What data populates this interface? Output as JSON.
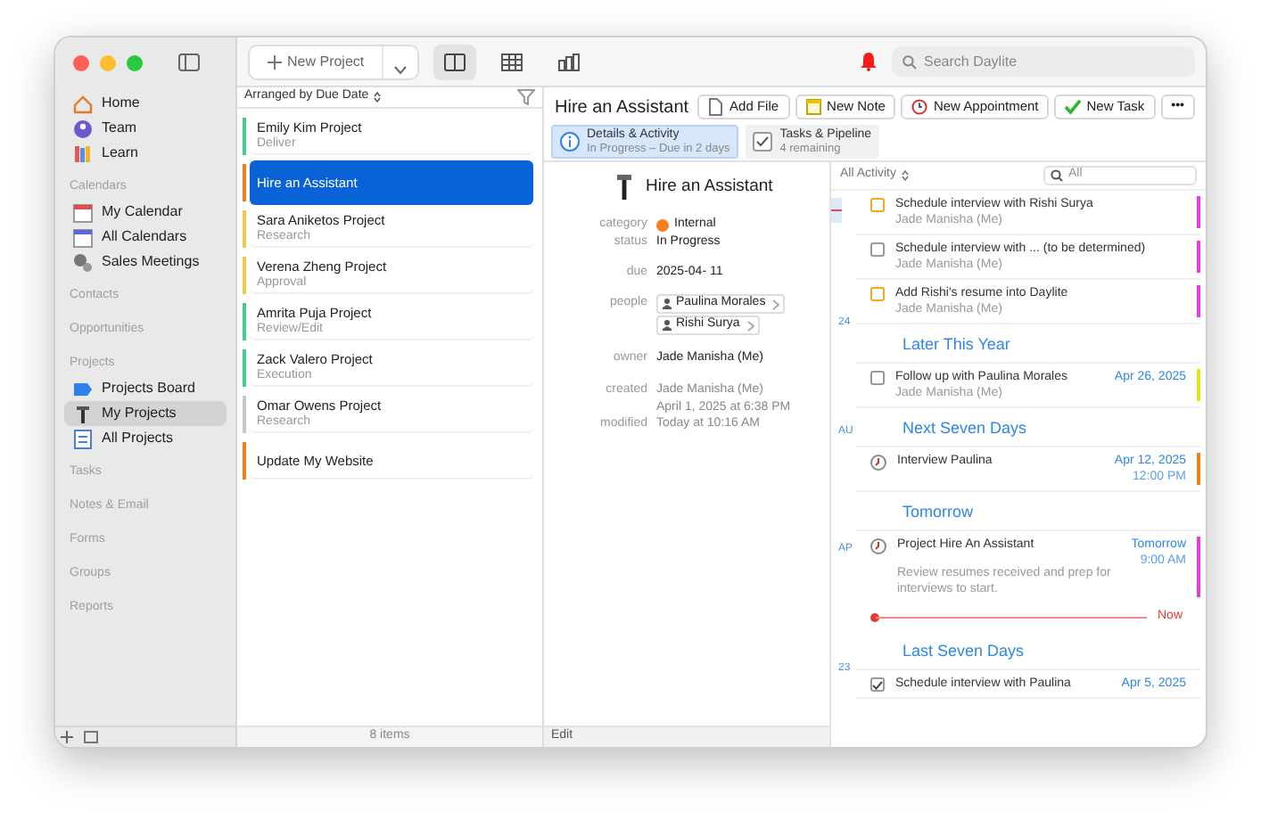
{
  "toolbar": {
    "new_project": "New Project",
    "views": [
      {
        "selected": true
      },
      {
        "selected": false
      },
      {
        "selected": false
      }
    ],
    "search_placeholder": "Search Daylite"
  },
  "sidebar": {
    "sections": [
      {
        "items": [
          {
            "label": "Home",
            "selected": false
          },
          {
            "label": "Team",
            "selected": false
          },
          {
            "label": "Learn",
            "selected": false
          }
        ]
      },
      {
        "heading": "Calendars",
        "items": [
          {
            "label": "My Calendar",
            "selected": false
          },
          {
            "label": "All Calendars",
            "selected": false
          },
          {
            "label": "Sales Meetings",
            "selected": false
          }
        ]
      },
      {
        "heading": "Contacts"
      },
      {
        "heading": "Opportunities"
      },
      {
        "heading": "Projects",
        "items": [
          {
            "label": "Projects Board",
            "selected": false
          },
          {
            "label": "My Projects",
            "selected": true
          },
          {
            "label": "All Projects",
            "selected": false
          }
        ]
      },
      {
        "heading": "Tasks"
      },
      {
        "heading": "Notes & Email"
      },
      {
        "heading": "Forms"
      },
      {
        "heading": "Groups"
      },
      {
        "heading": "Reports"
      }
    ]
  },
  "list": {
    "sort_label": "Arranged by Due Date",
    "items": [
      {
        "title": "Emily Kim Project",
        "stage": "Deliver",
        "color": "#3fcf8e",
        "selected": false
      },
      {
        "title": "Hire an Assistant",
        "color": "#f57f17",
        "selected": true
      },
      {
        "title": "Sara Aniketos Project",
        "stage": "Research",
        "color": "#f2c94c",
        "selected": false
      },
      {
        "title": "Verena Zheng Project",
        "stage": "Approval",
        "color": "#f2c94c",
        "selected": false
      },
      {
        "title": "Amrita Puja Project",
        "stage": "Review/Edit",
        "color": "#3fcf8e",
        "selected": false
      },
      {
        "title": "Zack Valero Project",
        "stage": "Execution",
        "color": "#3fcf8e",
        "selected": false
      },
      {
        "title": "Omar Owens Project",
        "stage": "Research",
        "color": "#c8c8c8",
        "selected": false
      },
      {
        "title": "Update My Website",
        "color": "#f57f17",
        "selected": false
      }
    ],
    "count": "8 items"
  },
  "detail": {
    "title": "Hire an Assistant",
    "buttons": [
      "Add File",
      "New Note",
      "New Appointment",
      "New Task"
    ],
    "more": "•••",
    "tabs": [
      {
        "title": "Details & Activity",
        "subtitle": "In Progress – Due in 2 days",
        "selected": true
      },
      {
        "title": "Tasks & Pipeline",
        "subtitle": "4 remaining",
        "selected": false
      }
    ],
    "info": {
      "name": "Hire an Assistant",
      "category_label": "category",
      "category": {
        "text": "Internal",
        "color": "#f5821f"
      },
      "status_label": "status",
      "status": "In Progress",
      "due_label": "due",
      "due": "2025-04- 11",
      "people_label": "people",
      "people": [
        "Paulina Morales",
        "Rishi Surya"
      ],
      "owner_label": "owner",
      "owner": "Jade Manisha (Me)",
      "created_label": "created",
      "created": [
        "Jade Manisha (Me)",
        "April 1, 2025 at 6:38 PM"
      ],
      "modified_label": "modified",
      "modified": "Today at 10:16 AM"
    },
    "edit": "Edit"
  },
  "activity": {
    "filter": "All Activity",
    "search_placeholder": "All",
    "timeline_labels": [
      "24",
      "AU",
      "AP",
      "23"
    ],
    "entries": [
      {
        "kind": "task",
        "title": "Schedule interview with Rishi Surya",
        "owner": "Jade Manisha (Me)",
        "checkbox": {
          "checked": false,
          "color": "#f5a623"
        },
        "color": "#e63ce6"
      },
      {
        "kind": "task",
        "title": "Schedule interview with ... (to be determined)",
        "owner": "Jade Manisha (Me)",
        "checkbox": {
          "checked": false,
          "color": "#999999"
        },
        "color": "#e63ce6"
      },
      {
        "kind": "task",
        "title": "Add Rishi's resume into Daylite",
        "owner": "Jade Manisha (Me)",
        "checkbox": {
          "checked": false,
          "color": "#f5a623"
        },
        "color": "#e63ce6"
      },
      {
        "kind": "heading",
        "title": "Later This Year"
      },
      {
        "kind": "task",
        "title": "Follow up with Paulina Morales",
        "owner": "Jade Manisha (Me)",
        "date": "Apr 26, 2025",
        "checkbox": {
          "checked": false,
          "color": "#999999"
        },
        "color": "#e8e21a"
      },
      {
        "kind": "heading",
        "title": "Next Seven Days"
      },
      {
        "kind": "appointment",
        "title": "Interview Paulina",
        "date": "Apr 12, 2025",
        "time": "12:00 PM",
        "color": "#f07f16"
      },
      {
        "kind": "heading",
        "title": "Tomorrow"
      },
      {
        "kind": "appointment",
        "title": "Project Hire An Assistant",
        "date": "Tomorrow",
        "time": "9:00 AM",
        "note": "Review resumes received and prep for interviews to start.",
        "color": "#e63ce6"
      },
      {
        "kind": "now",
        "title": "Now"
      },
      {
        "kind": "heading",
        "title": "Last Seven Days"
      },
      {
        "kind": "task",
        "title": "Schedule interview with Paulina",
        "date": "Apr 5, 2025",
        "checkbox": {
          "checked": true,
          "color": "#999999"
        }
      }
    ]
  }
}
